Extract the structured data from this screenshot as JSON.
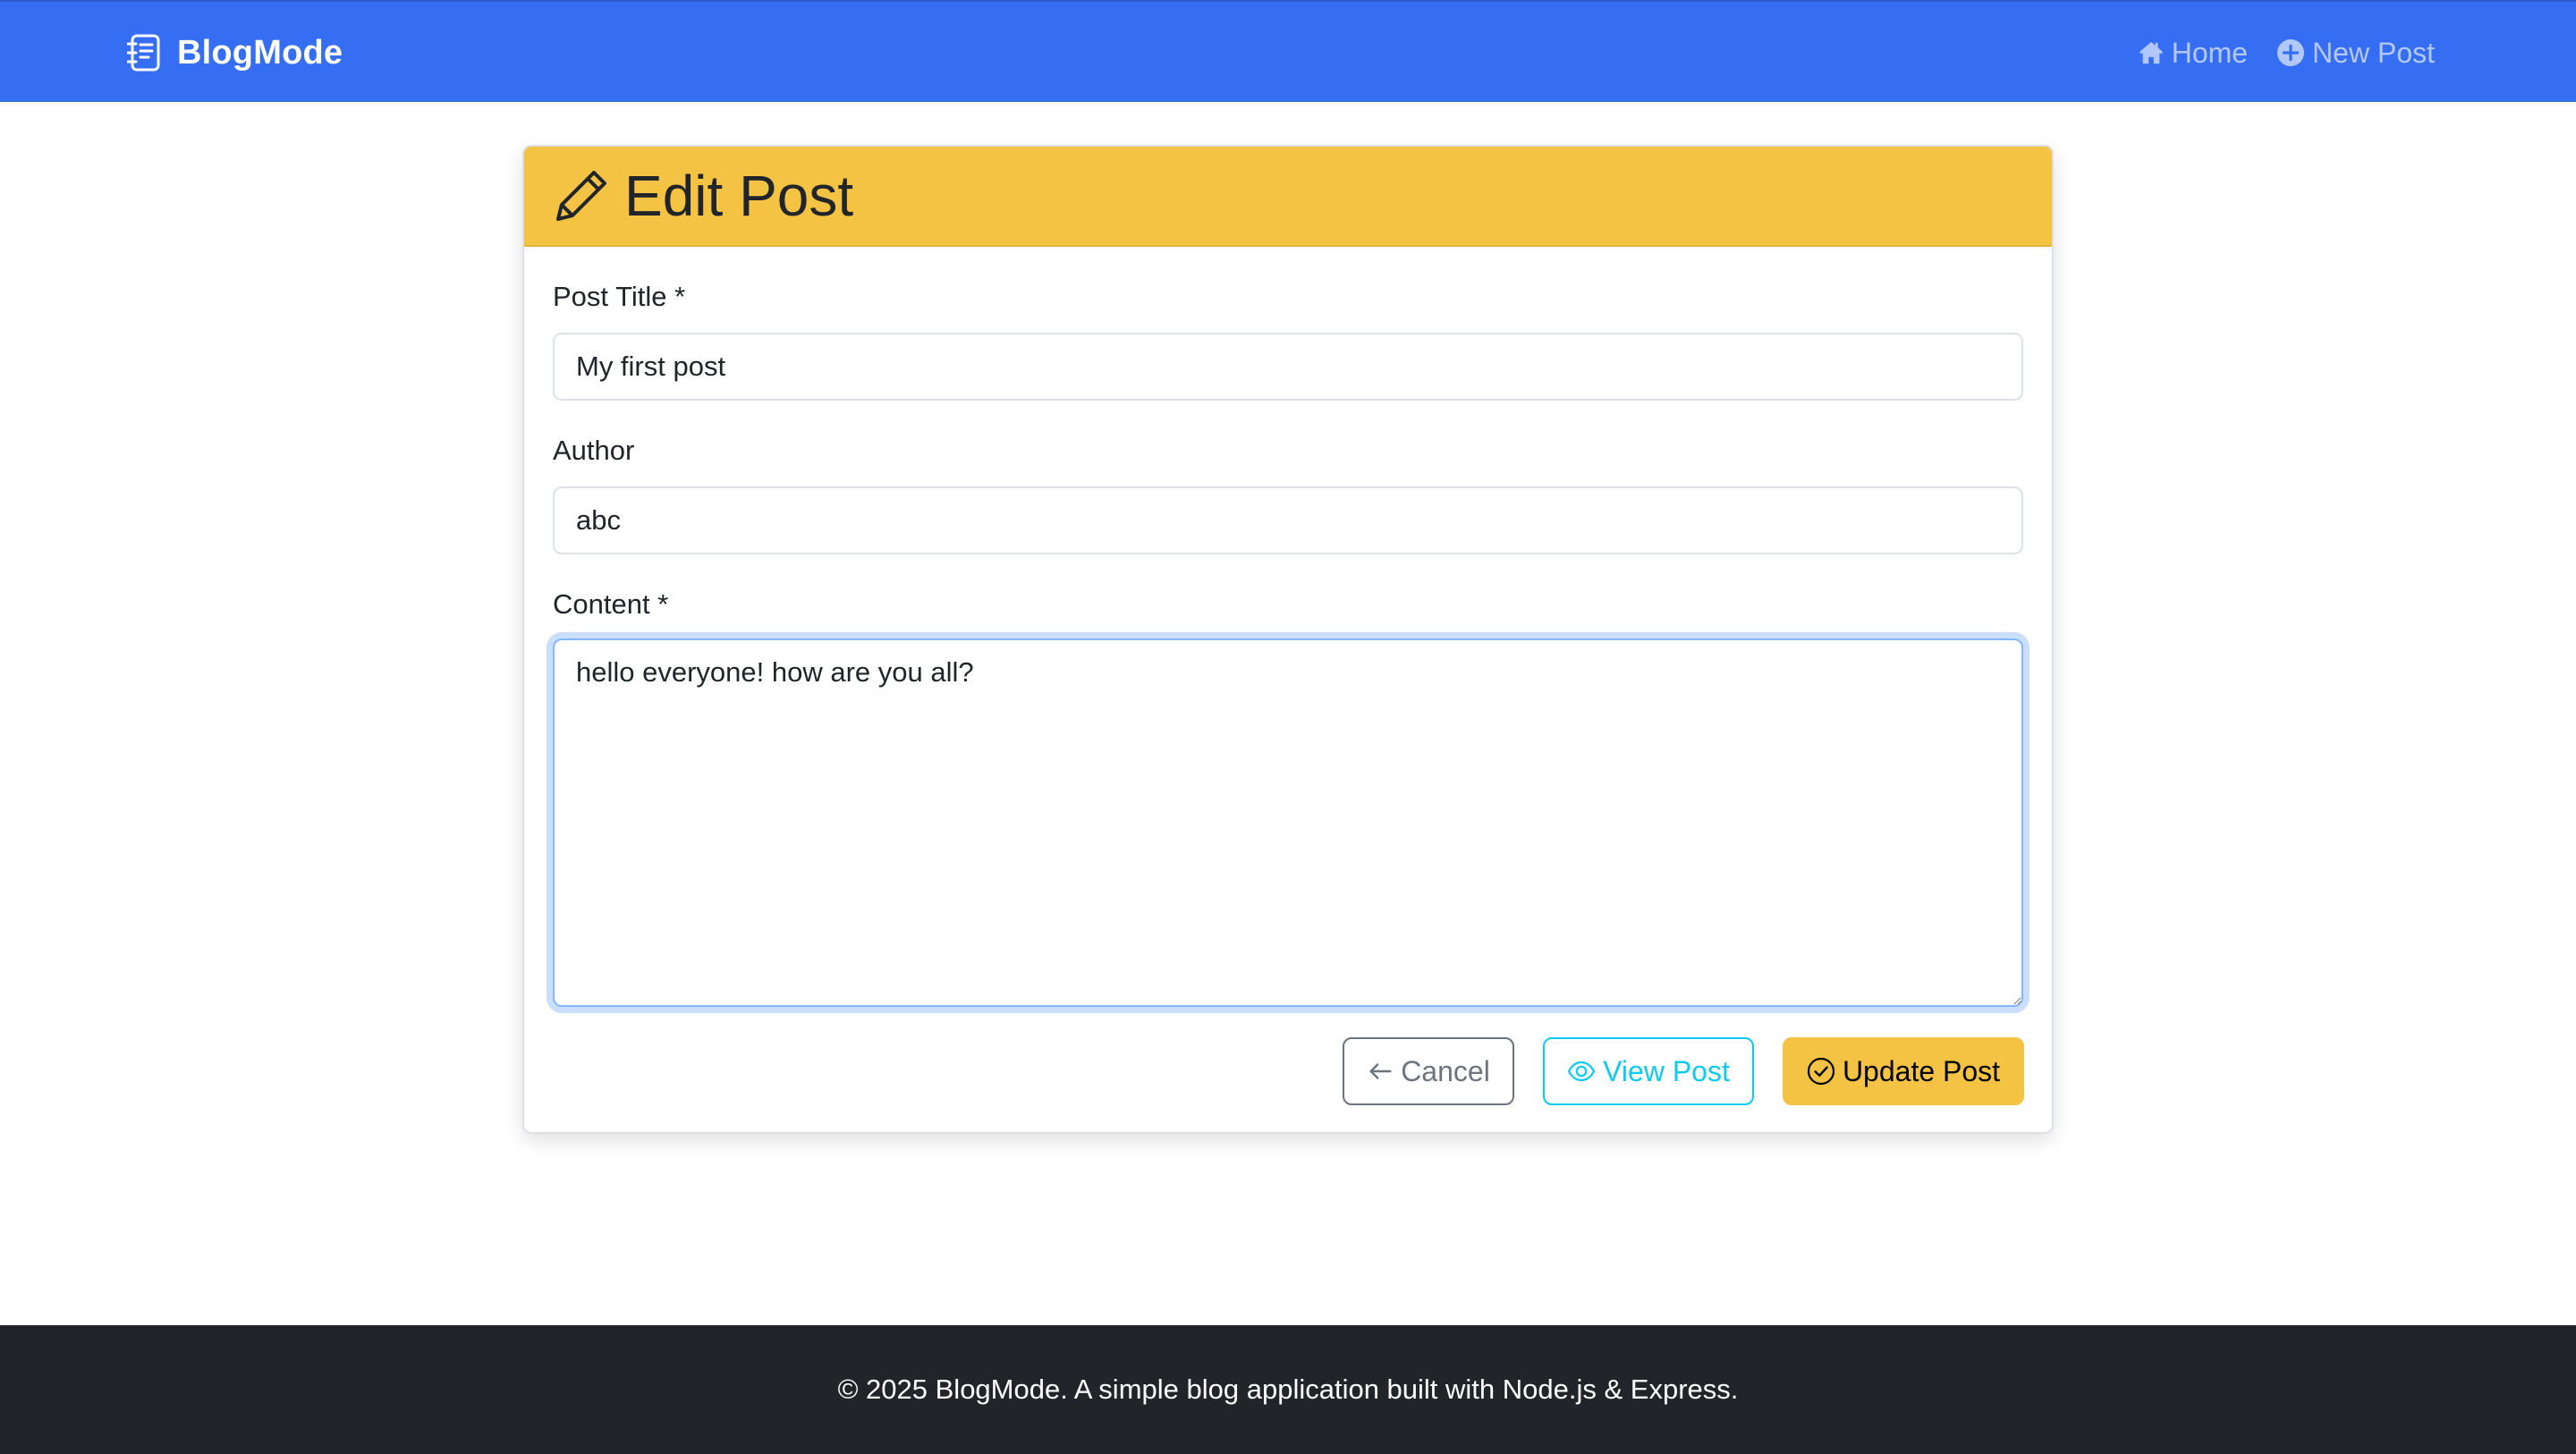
{
  "navbar": {
    "brand": "BlogMode",
    "brand_icon": "journal-text-icon",
    "links": [
      {
        "label": "Home",
        "icon": "house-icon"
      },
      {
        "label": "New Post",
        "icon": "plus-circle-icon"
      }
    ],
    "background_color": "#356ef2"
  },
  "form": {
    "header_title": "Edit Post",
    "header_icon": "pencil-icon",
    "header_color": "#f5c343",
    "title_label": "Post Title *",
    "title_value": "My first post",
    "author_label": "Author",
    "author_value": "abc",
    "content_label": "Content *",
    "content_value": "hello everyone! how are you all?",
    "buttons": {
      "cancel": "Cancel",
      "view": "View Post",
      "update": "Update Post"
    }
  },
  "footer": {
    "text": "© 2025 BlogMode. A simple blog application built with Node.js & Express."
  }
}
